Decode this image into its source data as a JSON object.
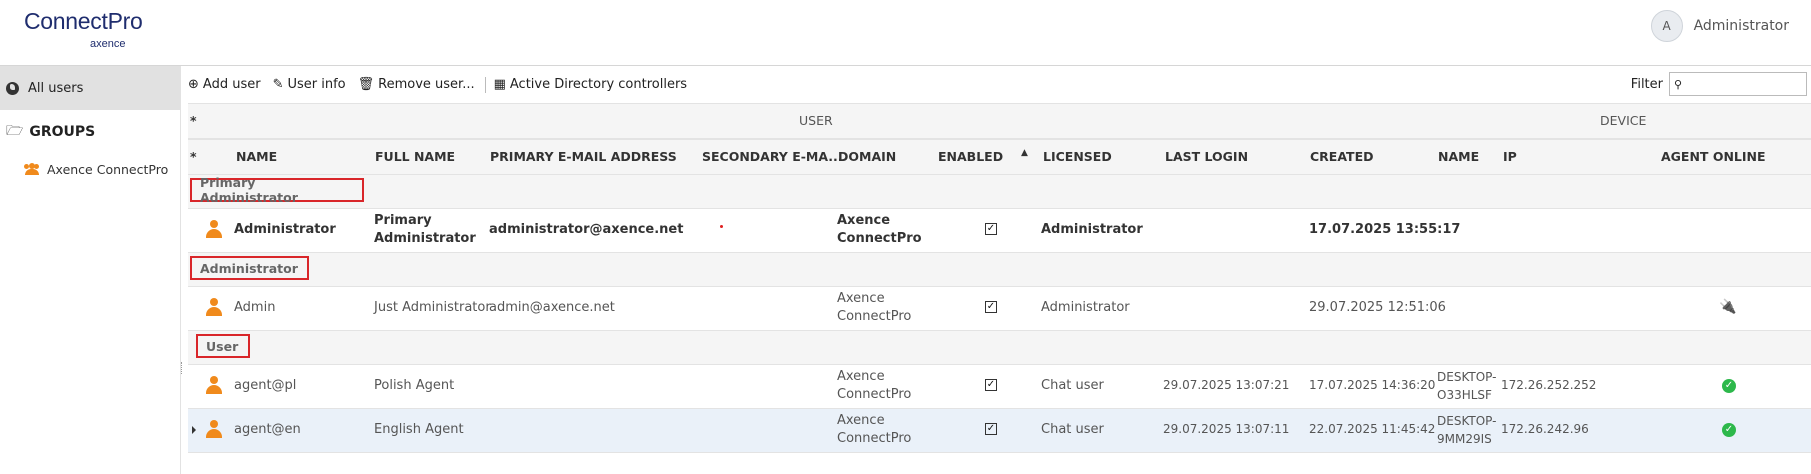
{
  "app": {
    "logo_main": "ConnectPro",
    "logo_sub": "axence",
    "user_initial": "A",
    "user_name": "Administrator"
  },
  "sidebar": {
    "all_users": "All users",
    "groups_label": "GROUPS",
    "groups": [
      "Axence ConnectPro"
    ]
  },
  "toolbar": {
    "add_user": "Add user",
    "user_info": "User info",
    "remove_user": "Remove user...",
    "ad_controllers": "Active Directory controllers",
    "filter_label": "Filter",
    "filter_value": ""
  },
  "table": {
    "group_headers": {
      "star": "*",
      "user": "USER",
      "device": "DEVICE"
    },
    "columns": {
      "star": "*",
      "name": "NAME",
      "full_name": "FULL NAME",
      "primary_email": "PRIMARY E-MAIL ADDRESS",
      "secondary_email": "SECONDARY E-MA...",
      "domain": "DOMAIN",
      "enabled": "ENABLED",
      "licensed": "LICENSED",
      "last_login": "LAST LOGIN",
      "created": "CREATED",
      "device_name": "NAME",
      "ip": "IP",
      "agent_online": "AGENT ONLINE"
    },
    "groups": [
      {
        "label": "Primary Administrator",
        "rows": [
          {
            "name": "Administrator",
            "full_name_1": "Primary",
            "full_name_2": "Administrator",
            "email": "administrator@axence.net",
            "domain_1": "Axence",
            "domain_2": "ConnectPro",
            "licensed": "Administrator",
            "last_login": "",
            "created": "17.07.2025 13:55:17",
            "device_1": "",
            "device_2": "",
            "ip": "",
            "agent": "none"
          }
        ]
      },
      {
        "label": "Administrator",
        "rows": [
          {
            "name": "Admin",
            "full_name": "Just Administrator",
            "email": "admin@axence.net",
            "domain_1": "Axence",
            "domain_2": "ConnectPro",
            "licensed": "Administrator",
            "last_login": "",
            "created": "29.07.2025 12:51:06",
            "device_1": "",
            "device_2": "",
            "ip": "",
            "agent": "plug"
          }
        ]
      },
      {
        "label": "User",
        "rows": [
          {
            "name": "agent@pl",
            "full_name": "Polish Agent",
            "email": "",
            "domain_1": "Axence",
            "domain_2": "ConnectPro",
            "licensed": "Chat user",
            "last_login": "29.07.2025 13:07:21",
            "created": "17.07.2025 14:36:20",
            "device_1": "DESKTOP-",
            "device_2": "O33HLSF",
            "ip": "172.26.252.252",
            "agent": "online"
          },
          {
            "name": "agent@en",
            "full_name": "English Agent",
            "email": "",
            "domain_1": "Axence",
            "domain_2": "ConnectPro",
            "licensed": "Chat user",
            "last_login": "29.07.2025 13:07:11",
            "created": "22.07.2025 11:45:42",
            "device_1": "DESKTOP-",
            "device_2": "9MM29IS",
            "ip": "172.26.242.96",
            "agent": "online"
          }
        ]
      }
    ]
  },
  "colors": {
    "accent_orange": "#f08a1c",
    "highlight_red": "#d9262a",
    "online_green": "#2db84b",
    "logo_navy": "#1f2d6e"
  }
}
